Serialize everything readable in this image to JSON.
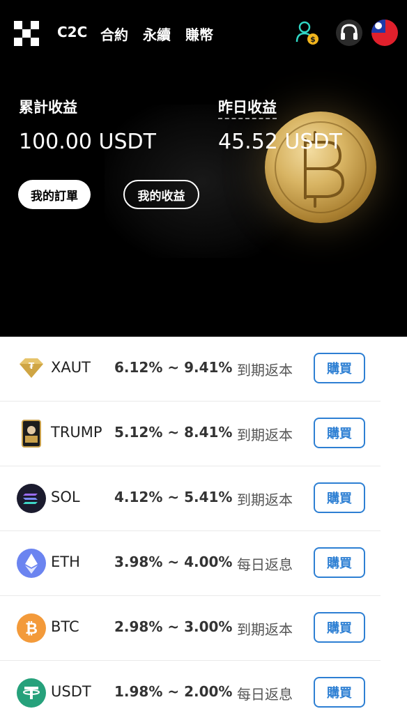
{
  "nav": {
    "items": [
      {
        "label": "C2C"
      },
      {
        "label": "合約"
      },
      {
        "label": "永續"
      },
      {
        "label": "賺幣"
      }
    ]
  },
  "icons": {
    "logo": "okx-logo",
    "user": "user-dollar-icon",
    "support": "headset-icon",
    "language": "taiwan-flag-icon"
  },
  "stats": {
    "total_label": "累計收益",
    "total_value": "100.00 USDT",
    "yesterday_label": "昨日收益",
    "yesterday_value": "45.52 USDT"
  },
  "buttons": {
    "orders": "我的訂單",
    "earnings": "我的收益"
  },
  "products": [
    {
      "symbol": "XAUT",
      "rate": "6.12% ~ 9.41%",
      "type": "到期返本",
      "buy": "購買",
      "icon": "xaut-icon"
    },
    {
      "symbol": "TRUMP",
      "rate": "5.12% ~ 8.41%",
      "type": "到期返本",
      "buy": "購買",
      "icon": "trump-icon"
    },
    {
      "symbol": "SOL",
      "rate": "4.12% ~ 5.41%",
      "type": "到期返本",
      "buy": "購買",
      "icon": "sol-icon"
    },
    {
      "symbol": "ETH",
      "rate": "3.98% ~ 4.00%",
      "type": "每日返息",
      "buy": "購買",
      "icon": "eth-icon"
    },
    {
      "symbol": "BTC",
      "rate": "2.98% ~ 3.00%",
      "type": "到期返本",
      "buy": "購買",
      "icon": "btc-icon"
    },
    {
      "symbol": "USDT",
      "rate": "1.98% ~ 2.00%",
      "type": "每日返息",
      "buy": "購買",
      "icon": "usdt-icon"
    }
  ],
  "colors": {
    "accent": "#2d7fd3",
    "hero_bg": "#000000"
  }
}
